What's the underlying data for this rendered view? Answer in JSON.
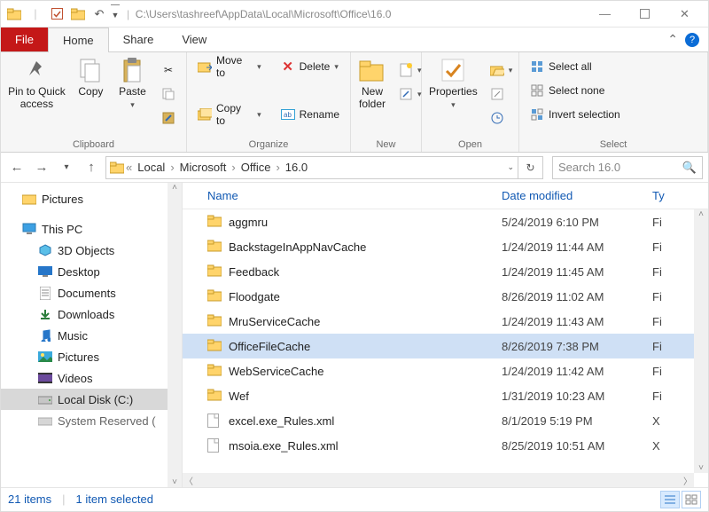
{
  "title_path": "C:\\Users\\tashreef\\AppData\\Local\\Microsoft\\Office\\16.0",
  "tabs": {
    "file": "File",
    "home": "Home",
    "share": "Share",
    "view": "View"
  },
  "ribbon": {
    "clipboard": {
      "label": "Clipboard",
      "pin": "Pin to Quick access",
      "copy": "Copy",
      "paste": "Paste"
    },
    "organize": {
      "label": "Organize",
      "moveto": "Move to",
      "copyto": "Copy to",
      "delete": "Delete",
      "rename": "Rename"
    },
    "new": {
      "label": "New",
      "newfolder": "New folder"
    },
    "open": {
      "label": "Open",
      "properties": "Properties"
    },
    "select": {
      "label": "Select",
      "selectall": "Select all",
      "selectnone": "Select none",
      "invert": "Invert selection"
    }
  },
  "breadcrumbs": [
    "Local",
    "Microsoft",
    "Office",
    "16.0"
  ],
  "search_placeholder": "Search 16.0",
  "columns": {
    "name": "Name",
    "date": "Date modified",
    "type": "Ty"
  },
  "tree": {
    "pictures": "Pictures",
    "thispc": "This PC",
    "objects3d": "3D Objects",
    "desktop": "Desktop",
    "documents": "Documents",
    "downloads": "Downloads",
    "music": "Music",
    "pictures2": "Pictures",
    "videos": "Videos",
    "localdisk": "Local Disk (C:)",
    "sysres": "System Reserved ("
  },
  "files": [
    {
      "name": "aggmru",
      "date": "5/24/2019 6:10 PM",
      "type": "Fi",
      "kind": "folder"
    },
    {
      "name": "BackstageInAppNavCache",
      "date": "1/24/2019 11:44 AM",
      "type": "Fi",
      "kind": "folder"
    },
    {
      "name": "Feedback",
      "date": "1/24/2019 11:45 AM",
      "type": "Fi",
      "kind": "folder"
    },
    {
      "name": "Floodgate",
      "date": "8/26/2019 11:02 AM",
      "type": "Fi",
      "kind": "folder"
    },
    {
      "name": "MruServiceCache",
      "date": "1/24/2019 11:43 AM",
      "type": "Fi",
      "kind": "folder"
    },
    {
      "name": "OfficeFileCache",
      "date": "8/26/2019 7:38 PM",
      "type": "Fi",
      "kind": "folder",
      "selected": true
    },
    {
      "name": "WebServiceCache",
      "date": "1/24/2019 11:42 AM",
      "type": "Fi",
      "kind": "folder"
    },
    {
      "name": "Wef",
      "date": "1/31/2019 10:23 AM",
      "type": "Fi",
      "kind": "folder"
    },
    {
      "name": "excel.exe_Rules.xml",
      "date": "8/1/2019 5:19 PM",
      "type": "X",
      "kind": "file"
    },
    {
      "name": "msoia.exe_Rules.xml",
      "date": "8/25/2019 10:51 AM",
      "type": "X",
      "kind": "file"
    }
  ],
  "status": {
    "count": "21 items",
    "selected": "1 item selected"
  }
}
